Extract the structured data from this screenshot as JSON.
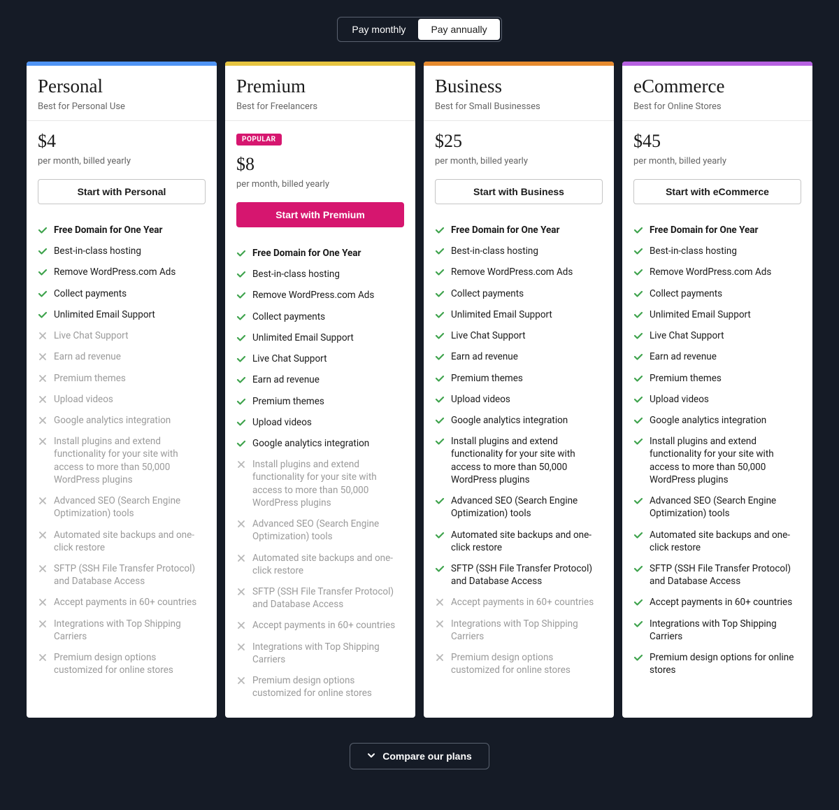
{
  "toggle": {
    "monthly": "Pay monthly",
    "annually": "Pay annually",
    "active": "annually"
  },
  "compare_label": "Compare our plans",
  "popular_label": "POPULAR",
  "colors": {
    "personal": "#4f94f4",
    "premium": "#e6c440",
    "business": "#e68a2e",
    "ecommerce": "#b660e0"
  },
  "features": [
    {
      "id": "domain",
      "label": "Free Domain for One Year",
      "bold": true
    },
    {
      "id": "hosting",
      "label": "Best-in-class hosting"
    },
    {
      "id": "ads",
      "label": "Remove WordPress.com Ads"
    },
    {
      "id": "payments",
      "label": "Collect payments"
    },
    {
      "id": "email",
      "label": "Unlimited Email Support"
    },
    {
      "id": "chat",
      "label": "Live Chat Support"
    },
    {
      "id": "adrev",
      "label": "Earn ad revenue"
    },
    {
      "id": "themes",
      "label": "Premium themes"
    },
    {
      "id": "videos",
      "label": "Upload videos"
    },
    {
      "id": "ga",
      "label": "Google analytics integration"
    },
    {
      "id": "plugins",
      "label": "Install plugins and extend functionality for your site with access to more than 50,000 WordPress plugins"
    },
    {
      "id": "seo",
      "label": "Advanced SEO (Search Engine Optimization) tools"
    },
    {
      "id": "backup",
      "label": "Automated site backups and one-click restore"
    },
    {
      "id": "sftp",
      "label": "SFTP (SSH File Transfer Protocol) and Database Access"
    },
    {
      "id": "countries",
      "label": "Accept payments in 60+ countries"
    },
    {
      "id": "shipping",
      "label": "Integrations with Top Shipping Carriers"
    },
    {
      "id": "design",
      "label": "Premium design options customized for online stores",
      "label_ecom": "Premium design options for online stores"
    }
  ],
  "plans": [
    {
      "key": "personal",
      "name": "Personal",
      "tagline": "Best for Personal Use",
      "price": "$4",
      "period": "per month, billed yearly",
      "cta": "Start with Personal",
      "popular": false,
      "primary_cta": false,
      "includes": [
        "domain",
        "hosting",
        "ads",
        "payments",
        "email"
      ]
    },
    {
      "key": "premium",
      "name": "Premium",
      "tagline": "Best for Freelancers",
      "price": "$8",
      "period": "per month, billed yearly",
      "cta": "Start with Premium",
      "popular": true,
      "primary_cta": true,
      "includes": [
        "domain",
        "hosting",
        "ads",
        "payments",
        "email",
        "chat",
        "adrev",
        "themes",
        "videos",
        "ga"
      ]
    },
    {
      "key": "business",
      "name": "Business",
      "tagline": "Best for Small Businesses",
      "price": "$25",
      "period": "per month, billed yearly",
      "cta": "Start with Business",
      "popular": false,
      "primary_cta": false,
      "includes": [
        "domain",
        "hosting",
        "ads",
        "payments",
        "email",
        "chat",
        "adrev",
        "themes",
        "videos",
        "ga",
        "plugins",
        "seo",
        "backup",
        "sftp"
      ]
    },
    {
      "key": "ecommerce",
      "name": "eCommerce",
      "tagline": "Best for Online Stores",
      "price": "$45",
      "period": "per month, billed yearly",
      "cta": "Start with eCommerce",
      "popular": false,
      "primary_cta": false,
      "includes": [
        "domain",
        "hosting",
        "ads",
        "payments",
        "email",
        "chat",
        "adrev",
        "themes",
        "videos",
        "ga",
        "plugins",
        "seo",
        "backup",
        "sftp",
        "countries",
        "shipping",
        "design"
      ]
    }
  ]
}
